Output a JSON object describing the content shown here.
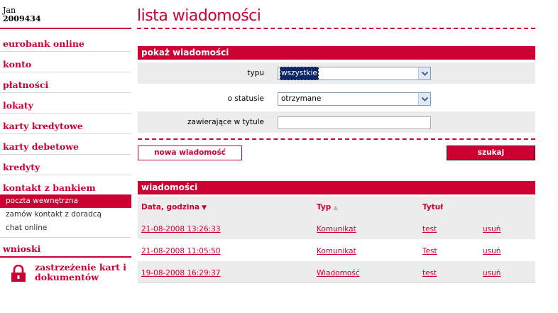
{
  "user": {
    "name": "Jan",
    "id": "2009434"
  },
  "sidebar": {
    "items": [
      {
        "label": "eurobank online"
      },
      {
        "label": "konto"
      },
      {
        "label": "płatności"
      },
      {
        "label": "lokaty"
      },
      {
        "label": "karty kredytowe"
      },
      {
        "label": "karty debetowe"
      },
      {
        "label": "kredyty"
      },
      {
        "label": "kontakt z bankiem"
      }
    ],
    "subitems": [
      {
        "label": "poczta wewnętrzna",
        "active": true
      },
      {
        "label": "zamów kontakt z doradcą"
      },
      {
        "label": "chat online"
      }
    ],
    "wnioski": "wnioski",
    "lock_text_line1": "zastrzeżenie kart i",
    "lock_text_line2": "dokumentów"
  },
  "page": {
    "title": "lista wiadomości"
  },
  "filter": {
    "header": "pokaż wiadomości",
    "type_label": "typu",
    "type_value": "wszystkie",
    "status_label": "o statusie",
    "status_value": "otrzymane",
    "title_label": "zawierające w tytule",
    "title_value": ""
  },
  "buttons": {
    "new_message": "nowa wiadomość",
    "search": "szukaj"
  },
  "messages": {
    "header": "wiadomości",
    "columns": {
      "date": "Data, godzina",
      "type": "Typ",
      "title": "Tytuł"
    },
    "rows": [
      {
        "date": "21-08-2008 13:26:33",
        "type": "Komunikat",
        "title": "test",
        "action": "usuń"
      },
      {
        "date": "21-08-2008 11:05:50",
        "type": "Komunikat",
        "title": "Test",
        "action": "usuń"
      },
      {
        "date": "19-08-2008 16:29:37",
        "type": "Wiadomość",
        "title": "test",
        "action": "usuń"
      }
    ]
  },
  "colors": {
    "accent": "#cc0033",
    "row_grey": "#ececec"
  },
  "icons": {
    "lock": "lock-icon",
    "dropdown": "chevron-down-icon",
    "sort_desc": "sort-desc-icon",
    "sort_asc": "sort-asc-icon"
  }
}
